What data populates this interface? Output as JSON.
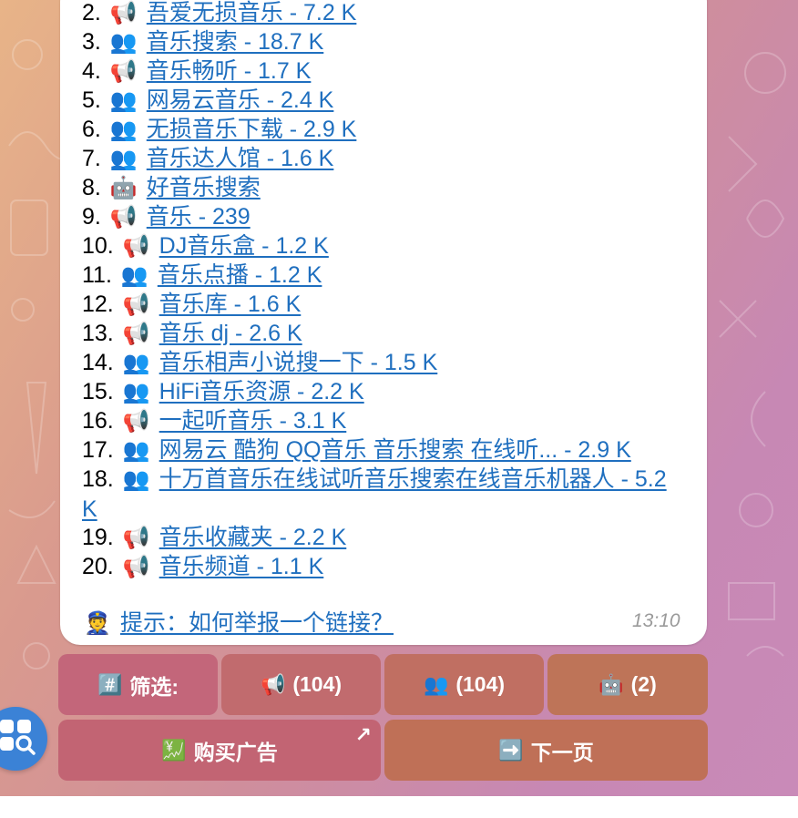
{
  "results": [
    {
      "num": "2.",
      "emoji": "📢",
      "text": "吾爱无损音乐 - 7.2 K"
    },
    {
      "num": "3.",
      "emoji": "👥",
      "text": "音乐搜索 - 18.7 K"
    },
    {
      "num": "4.",
      "emoji": "📢",
      "text": "音乐畅听 - 1.7 K"
    },
    {
      "num": "5.",
      "emoji": "👥",
      "text": "网易云音乐 - 2.4 K"
    },
    {
      "num": "6.",
      "emoji": "👥",
      "text": "无损音乐下载 - 2.9 K"
    },
    {
      "num": "7.",
      "emoji": "👥",
      "text": "音乐达人馆 - 1.6 K"
    },
    {
      "num": "8.",
      "emoji": "🤖",
      "text": "好音乐搜索"
    },
    {
      "num": "9.",
      "emoji": "📢",
      "text": "音乐 - 239"
    },
    {
      "num": "10.",
      "emoji": "📢",
      "text": "DJ音乐盒 - 1.2 K"
    },
    {
      "num": "11.",
      "emoji": "👥",
      "text": "音乐点播 - 1.2 K"
    },
    {
      "num": "12.",
      "emoji": "📢",
      "text": "音乐库 - 1.6 K"
    },
    {
      "num": "13.",
      "emoji": "📢",
      "text": "音乐 dj - 2.6 K"
    },
    {
      "num": "14.",
      "emoji": "👥",
      "text": "音乐相声小说搜一下 - 1.5 K"
    },
    {
      "num": "15.",
      "emoji": "👥",
      "text": "HiFi音乐资源 - 2.2 K"
    },
    {
      "num": "16.",
      "emoji": "📢",
      "text": "一起听音乐 - 3.1 K"
    },
    {
      "num": "17.",
      "emoji": "👥",
      "text": "网易云 酷狗 QQ音乐 音乐搜索 在线听... - 2.9 K"
    },
    {
      "num": "18.",
      "emoji": "👥",
      "text": "十万首音乐在线试听音乐搜索在线音乐机器人 - 5.2 K"
    },
    {
      "num": "19.",
      "emoji": "📢",
      "text": "音乐收藏夹 - 2.2 K"
    },
    {
      "num": "20.",
      "emoji": "📢",
      "text": "音乐频道 - 1.1 K"
    }
  ],
  "hint": {
    "emoji": "👮",
    "text": "提示：如何举报一个链接？"
  },
  "message_time": "13:10",
  "keyboard": {
    "filter": {
      "icon": "#️⃣",
      "label": "筛选:"
    },
    "channels": {
      "icon": "📢",
      "label": "(104)"
    },
    "groups": {
      "icon": "👥",
      "label": "(104)"
    },
    "bots": {
      "icon": "🤖",
      "label": "(2)"
    },
    "buy_ads": {
      "icon": "💹",
      "label": "购买广告",
      "external_icon": "↗"
    },
    "next_page": {
      "icon": "➡️",
      "label": "下一页"
    }
  },
  "colors": {
    "link": "#1f6fbf",
    "fab": "#3b82d6",
    "button_pink": "#c3667a",
    "button_orange": "#be7458"
  },
  "icons": {
    "fab": "apps-search-icon",
    "external": "external-link-icon"
  }
}
